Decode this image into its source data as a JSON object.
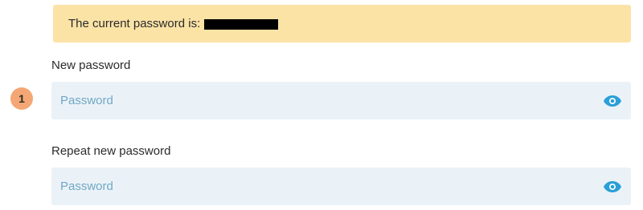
{
  "notice": {
    "text": "The current password is:"
  },
  "step_badge": "1",
  "fields": {
    "new_password": {
      "label": "New password",
      "placeholder": "Password",
      "value": ""
    },
    "repeat_password": {
      "label": "Repeat new password",
      "placeholder": "Password",
      "value": ""
    }
  },
  "icons": {
    "visibility_toggle": "eye-icon"
  },
  "colors": {
    "notice_background": "#fbe3a6",
    "input_background": "#ebf2f7",
    "placeholder": "#6fa8c6",
    "icon_accent": "#2a9fd8",
    "badge": "#f4a774"
  }
}
